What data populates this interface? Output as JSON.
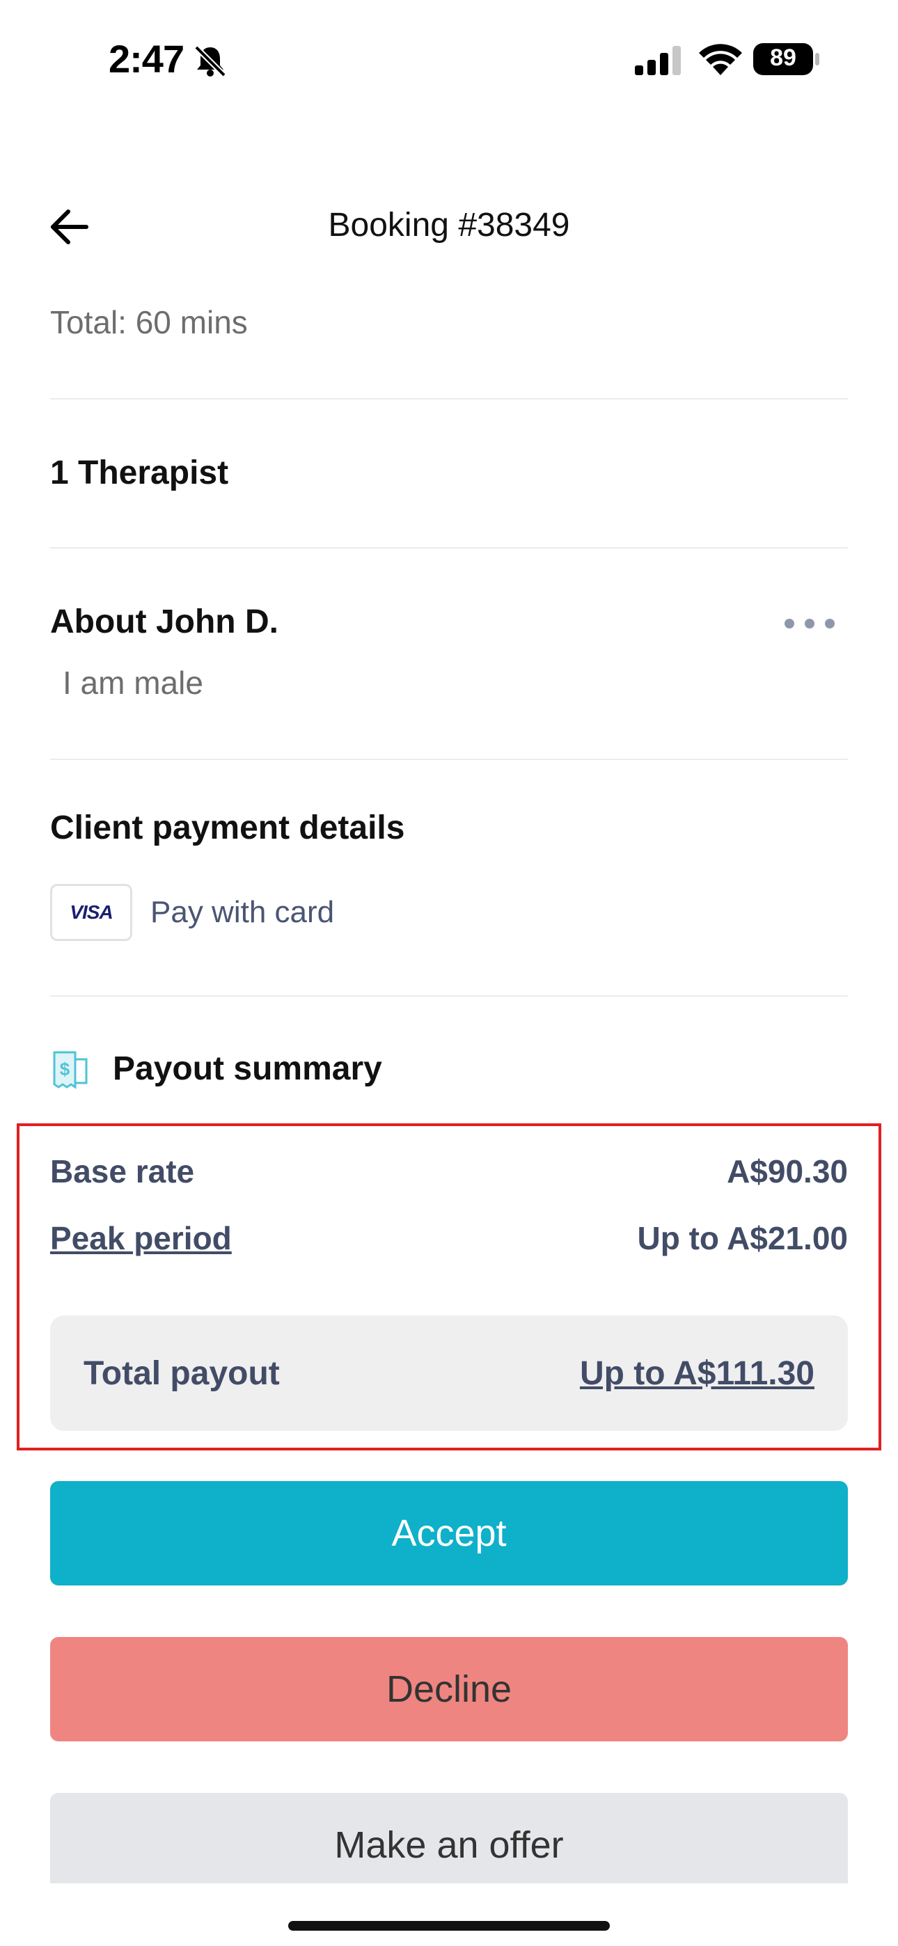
{
  "status_bar": {
    "time": "2:47",
    "battery": "89"
  },
  "header": {
    "title": "Booking #38349"
  },
  "booking": {
    "total_duration": "Total: 60 mins",
    "therapists": "1 Therapist",
    "about_title": "About John D.",
    "about_text": "I am male"
  },
  "payment": {
    "title": "Client payment details",
    "card_brand": "VISA",
    "method_label": "Pay with card"
  },
  "payout": {
    "title": "Payout summary",
    "base_rate_label": "Base rate",
    "base_rate_value": "A$90.30",
    "peak_label": "Peak period",
    "peak_value": "Up to A$21.00",
    "total_label": "Total payout",
    "total_value": "Up to A$111.30"
  },
  "actions": {
    "accept": "Accept",
    "decline": "Decline",
    "offer": "Make an offer"
  },
  "colors": {
    "accent": "#0fb0c9",
    "decline": "#ef8580",
    "highlight": "#e02020"
  }
}
